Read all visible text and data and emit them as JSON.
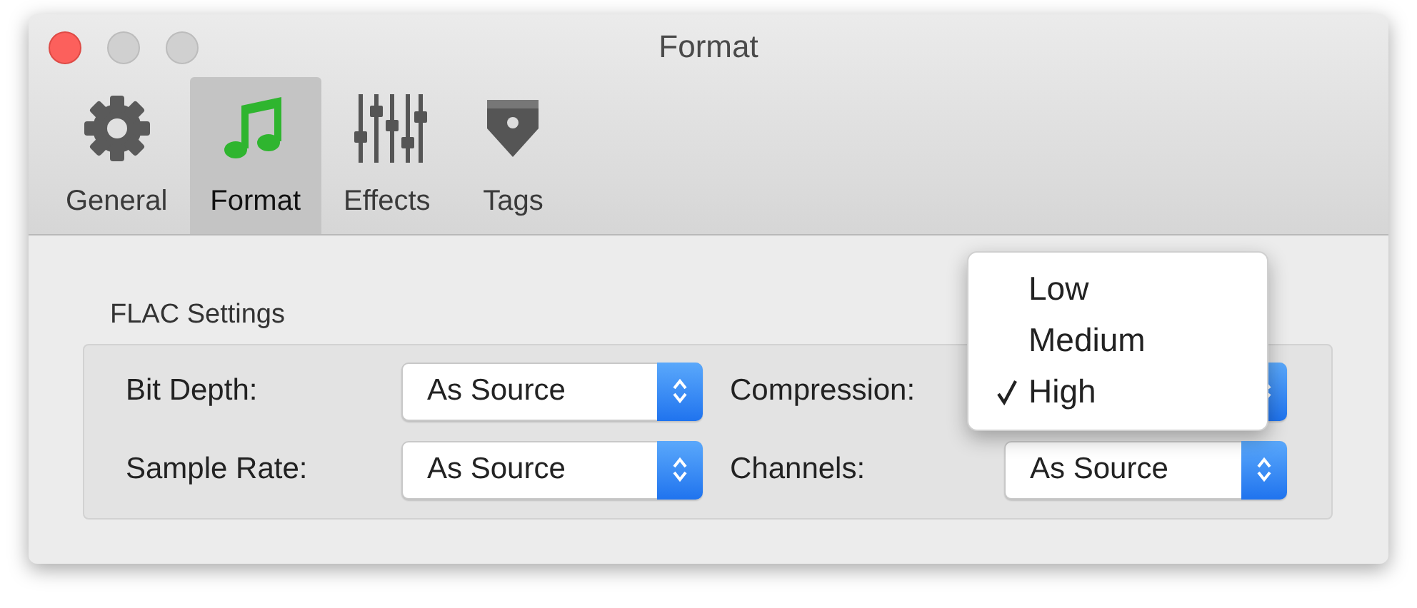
{
  "window": {
    "title": "Format",
    "buttons": [
      {
        "kind": "close"
      },
      {
        "kind": "minimize"
      },
      {
        "kind": "zoom"
      }
    ]
  },
  "toolbar": [
    {
      "label": "General",
      "kind": "gear",
      "selected": false
    },
    {
      "label": "Format",
      "kind": "note",
      "selected": true
    },
    {
      "label": "Effects",
      "kind": "sliders",
      "selected": false
    },
    {
      "label": "Tags",
      "kind": "tag",
      "selected": false
    }
  ],
  "section": {
    "title": "FLAC Settings",
    "fields": [
      {
        "label": "Bit Depth:",
        "value": "As Source"
      },
      {
        "label": "Compression:"
      },
      {
        "label": "Sample Rate:",
        "value": "As Source"
      },
      {
        "label": "Channels:",
        "value": "As Source"
      }
    ]
  },
  "popup_menu": {
    "items": [
      {
        "label": "Low",
        "checked": false
      },
      {
        "label": "Medium",
        "checked": false
      },
      {
        "label": "High",
        "checked": true
      }
    ]
  }
}
